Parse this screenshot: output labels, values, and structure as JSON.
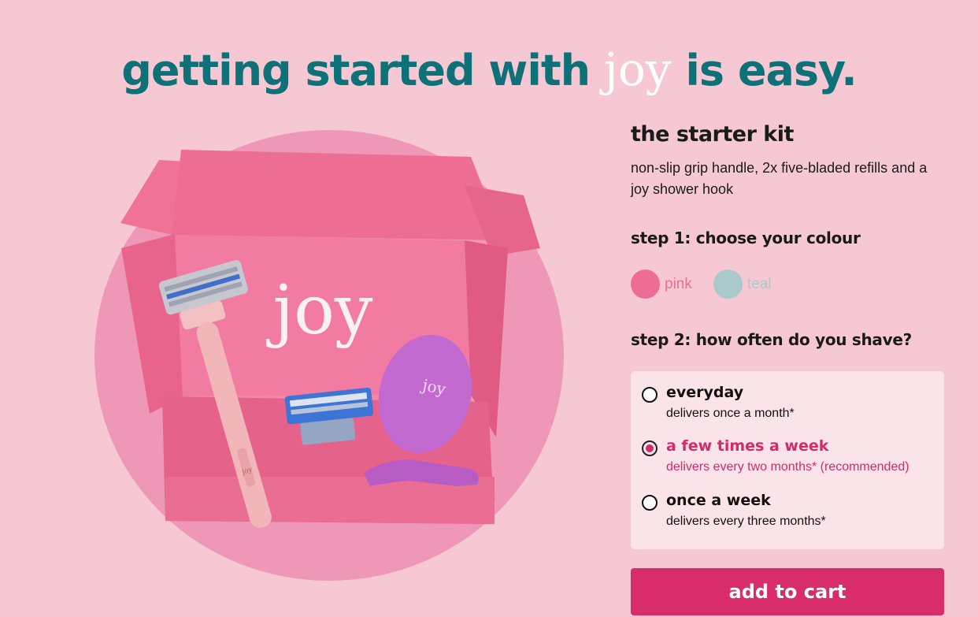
{
  "headline": {
    "part1": "getting started with ",
    "brand": "joy",
    "part2": " is easy."
  },
  "hero": {
    "box_logo": "joy",
    "razor_logo": "joy",
    "hook_logo": "joy"
  },
  "product": {
    "title": "the starter kit",
    "description": "non-slip grip handle, 2x five-bladed refills and a joy shower hook"
  },
  "step1": {
    "label": "step 1: choose your colour",
    "colours": [
      {
        "name": "pink",
        "swatch": "#ee6d96",
        "text_color": "#ee6d96"
      },
      {
        "name": "teal",
        "swatch": "#a9c9ca",
        "text_color": "#a9c9ca"
      }
    ]
  },
  "step2": {
    "label": "step 2: how often do you shave?",
    "selected": 1,
    "options": [
      {
        "title": "everyday",
        "subtitle": "delivers once a month*"
      },
      {
        "title": "a few times a week",
        "subtitle": "delivers every two months* (recommended)"
      },
      {
        "title": "once a week",
        "subtitle": "delivers every three months*"
      }
    ]
  },
  "cart": {
    "label": "add to cart"
  },
  "colors": {
    "background": "#f6c8d4",
    "headline": "#0f7178",
    "accent": "#d92c6b",
    "options_panel": "#fbe3ea",
    "hero_circle": "#ee97b7"
  }
}
